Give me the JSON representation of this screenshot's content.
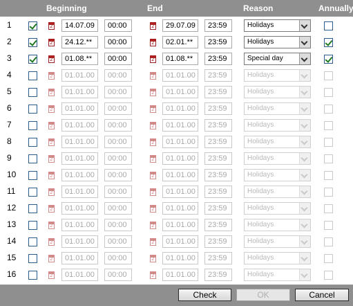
{
  "header": {
    "beginning": "Beginning",
    "end": "End",
    "reason": "Reason",
    "annually": "Annually"
  },
  "rows": [
    {
      "num": "1",
      "enabled": true,
      "checked": true,
      "begin_date": "14.07.09",
      "begin_time": "00:00",
      "end_date": "29.07.09",
      "end_time": "23:59",
      "reason": "Holidays",
      "annually": false
    },
    {
      "num": "2",
      "enabled": true,
      "checked": true,
      "begin_date": "24.12.**",
      "begin_time": "00:00",
      "end_date": "02.01.**",
      "end_time": "23:59",
      "reason": "Holidays",
      "annually": true
    },
    {
      "num": "3",
      "enabled": true,
      "checked": true,
      "begin_date": "01.08.**",
      "begin_time": "00:00",
      "end_date": "01.08.**",
      "end_time": "23:59",
      "reason": "Special day",
      "annually": true
    },
    {
      "num": "4",
      "enabled": false,
      "checked": false,
      "begin_date": "01.01.00",
      "begin_time": "00:00",
      "end_date": "01.01.00",
      "end_time": "23:59",
      "reason": "Holidays",
      "annually": false
    },
    {
      "num": "5",
      "enabled": false,
      "checked": false,
      "begin_date": "01.01.00",
      "begin_time": "00:00",
      "end_date": "01.01.00",
      "end_time": "23:59",
      "reason": "Holidays",
      "annually": false
    },
    {
      "num": "6",
      "enabled": false,
      "checked": false,
      "begin_date": "01.01.00",
      "begin_time": "00:00",
      "end_date": "01.01.00",
      "end_time": "23:59",
      "reason": "Holidays",
      "annually": false
    },
    {
      "num": "7",
      "enabled": false,
      "checked": false,
      "begin_date": "01.01.00",
      "begin_time": "00:00",
      "end_date": "01.01.00",
      "end_time": "23:59",
      "reason": "Holidays",
      "annually": false
    },
    {
      "num": "8",
      "enabled": false,
      "checked": false,
      "begin_date": "01.01.00",
      "begin_time": "00:00",
      "end_date": "01.01.00",
      "end_time": "23:59",
      "reason": "Holidays",
      "annually": false
    },
    {
      "num": "9",
      "enabled": false,
      "checked": false,
      "begin_date": "01.01.00",
      "begin_time": "00:00",
      "end_date": "01.01.00",
      "end_time": "23:59",
      "reason": "Holidays",
      "annually": false
    },
    {
      "num": "10",
      "enabled": false,
      "checked": false,
      "begin_date": "01.01.00",
      "begin_time": "00:00",
      "end_date": "01.01.00",
      "end_time": "23:59",
      "reason": "Holidays",
      "annually": false
    },
    {
      "num": "11",
      "enabled": false,
      "checked": false,
      "begin_date": "01.01.00",
      "begin_time": "00:00",
      "end_date": "01.01.00",
      "end_time": "23:59",
      "reason": "Holidays",
      "annually": false
    },
    {
      "num": "12",
      "enabled": false,
      "checked": false,
      "begin_date": "01.01.00",
      "begin_time": "00:00",
      "end_date": "01.01.00",
      "end_time": "23:59",
      "reason": "Holidays",
      "annually": false
    },
    {
      "num": "13",
      "enabled": false,
      "checked": false,
      "begin_date": "01.01.00",
      "begin_time": "00:00",
      "end_date": "01.01.00",
      "end_time": "23:59",
      "reason": "Holidays",
      "annually": false
    },
    {
      "num": "14",
      "enabled": false,
      "checked": false,
      "begin_date": "01.01.00",
      "begin_time": "00:00",
      "end_date": "01.01.00",
      "end_time": "23:59",
      "reason": "Holidays",
      "annually": false
    },
    {
      "num": "15",
      "enabled": false,
      "checked": false,
      "begin_date": "01.01.00",
      "begin_time": "00:00",
      "end_date": "01.01.00",
      "end_time": "23:59",
      "reason": "Holidays",
      "annually": false
    },
    {
      "num": "16",
      "enabled": false,
      "checked": false,
      "begin_date": "01.01.00",
      "begin_time": "00:00",
      "end_date": "01.01.00",
      "end_time": "23:59",
      "reason": "Holidays",
      "annually": false
    }
  ],
  "buttons": {
    "check": "Check",
    "ok": "OK",
    "cancel": "Cancel"
  },
  "icons": {
    "row_checkbox": "checkbox-icon",
    "calendar": "calendar-icon",
    "dropdown": "chevron-down-icon"
  },
  "colors": {
    "header_bg": "#8f8f8f",
    "footer_bg": "#8f8f8f",
    "check_mark": "#1f7a1f",
    "calendar": "#b22020"
  }
}
